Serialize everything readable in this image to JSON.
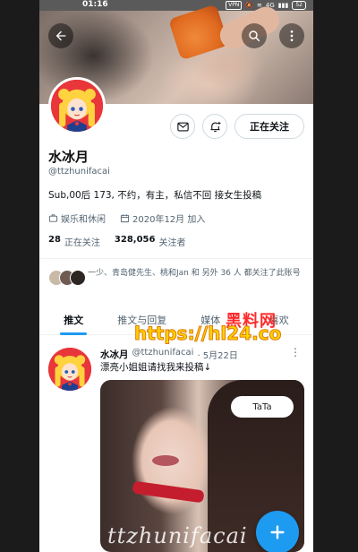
{
  "status_bar": {
    "time": "01:16",
    "vpn": "VPN",
    "network": "4G",
    "battery": "52"
  },
  "profile": {
    "display_name": "水冰月",
    "handle": "@ttzhunifacai",
    "bio": "Sub,00后 173, 不约，有主，私信不回  接女生投稿",
    "category": "娱乐和休闲",
    "joined": "2020年12月 加入",
    "following_count": "28",
    "following_label": "正在关注",
    "followers_count": "328,056",
    "followers_label": "关注者",
    "follow_button": "正在关注",
    "followed_by": "一少、青岛健先生、桃和Jan 和 另外 36 人 都关注了此账号"
  },
  "tabs": [
    {
      "label": "推文"
    },
    {
      "label": "推文与回复"
    },
    {
      "label": "媒体"
    },
    {
      "label": "喜欢"
    }
  ],
  "tweet": {
    "author": "水冰月",
    "handle": "@ttzhunifacai",
    "date": "· 5月22日",
    "text": "漂亮小姐姐请找我来投稿↓",
    "image_bubble": "TaTa",
    "image_watermark": "ttzhunifacai"
  },
  "overlay": {
    "line1": "黑料网",
    "line2": "https://hl24.co"
  },
  "colors": {
    "accent": "#1d9bf0",
    "avatar_bg": "#e8363a"
  }
}
